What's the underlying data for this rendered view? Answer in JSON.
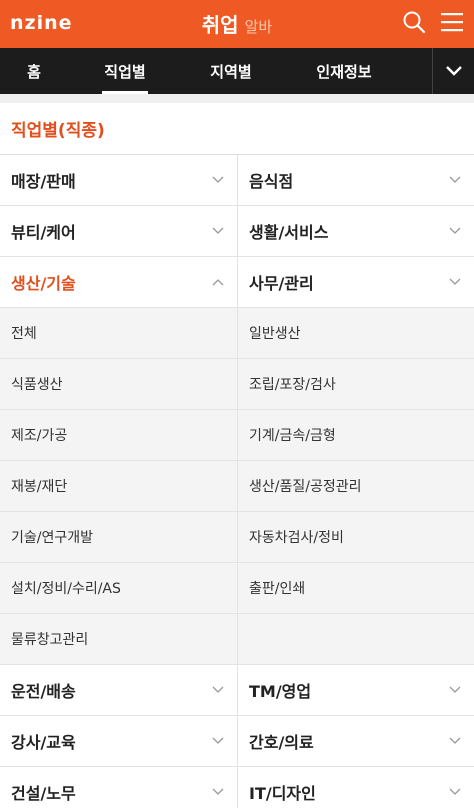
{
  "header": {
    "logo": "nzine",
    "title": "취업",
    "subtitle": "알바"
  },
  "tabs": [
    {
      "label": "홈"
    },
    {
      "label": "직업별"
    },
    {
      "label": "지역별"
    },
    {
      "label": "인재정보"
    }
  ],
  "section": {
    "title": "직업별(직종)"
  },
  "categories": {
    "r1": [
      "매장/판매",
      "음식점"
    ],
    "r2": [
      "뷰티/케어",
      "생활/서비스"
    ],
    "r3": [
      "생산/기술",
      "사무/관리"
    ],
    "r4": [
      "운전/배송",
      "TM/영업"
    ],
    "r5": [
      "강사/교육",
      "간호/의료"
    ],
    "r6": [
      "건설/노무",
      "IT/디자인"
    ]
  },
  "subcategories": [
    [
      "전체",
      "일반생산"
    ],
    [
      "식품생산",
      "조립/포장/검사"
    ],
    [
      "제조/가공",
      "기계/금속/금형"
    ],
    [
      "재봉/재단",
      "생산/품질/공정관리"
    ],
    [
      "기술/연구개발",
      "자동차검사/정비"
    ],
    [
      "설치/정비/수리/AS",
      "출판/인쇄"
    ],
    [
      "물류창고관리",
      ""
    ]
  ],
  "colors": {
    "brand": "#ef5a24",
    "accent_text": "#e24f1d",
    "tabbar": "#1c1c1c"
  },
  "icons": {
    "search": "search-icon",
    "menu": "hamburger-menu-icon",
    "more": "chevron-down-icon"
  }
}
